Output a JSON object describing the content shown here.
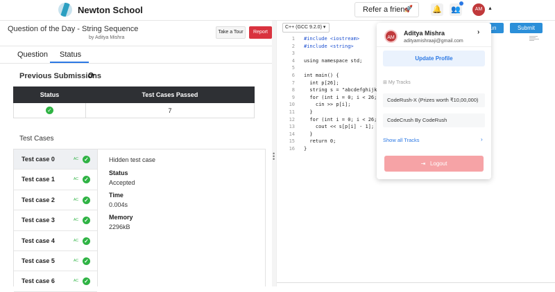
{
  "topbar": {
    "brand": "Newton School",
    "refer_label": "Refer a friend",
    "refer_icon": "rocket-icon",
    "avatar_initials": "AM"
  },
  "question": {
    "title": "Question of the Day - String Sequence",
    "author": "by Aditya Mishra",
    "tour_label": "Take a Tour",
    "report_label": "Report"
  },
  "tabs": [
    "Question",
    "Status"
  ],
  "active_tab": "Status",
  "submissions": {
    "heading": "Previous Submissions",
    "headers": [
      "Status",
      "Test Cases Passed"
    ],
    "rows": [
      {
        "status": "accepted",
        "passed": "7"
      }
    ]
  },
  "testcases": {
    "heading": "Test Cases",
    "items": [
      {
        "label": "Test case 0",
        "badge": "AC"
      },
      {
        "label": "Test case 1",
        "badge": "AC"
      },
      {
        "label": "Test case 2",
        "badge": "AC"
      },
      {
        "label": "Test case 3",
        "badge": "AC"
      },
      {
        "label": "Test case 4",
        "badge": "AC"
      },
      {
        "label": "Test case 5",
        "badge": "AC"
      },
      {
        "label": "Test case 6",
        "badge": "AC"
      }
    ],
    "detail": {
      "hidden": "Hidden test case",
      "status_label": "Status",
      "status_value": "Accepted",
      "time_label": "Time",
      "time_value": "0.004s",
      "memory_label": "Memory",
      "memory_value": "2296kB"
    }
  },
  "editor": {
    "language": "C++ (GCC 9.2.0)",
    "run_label": "un",
    "submit_label": "Submit",
    "lines": [
      "#include <iostream>",
      "#include <string>",
      "",
      "using namespace std;",
      "",
      "int main() {",
      "  int p[26];",
      "  string s = \"abcdefghijk",
      "  for (int i = 0; i < 26;",
      "    cin >> p[i];",
      "  }",
      "  for (int i = 0; i < 26;",
      "    cout << s[p[i] - 1];",
      "  }",
      "  return 0;",
      "}"
    ]
  },
  "dropdown": {
    "name": "Aditya Mishra",
    "email": "adityamishraaji@gmail.com",
    "update_label": "Update Profile",
    "tracks_heading": "My Tracks",
    "tracks": [
      "CodeRush-X (Prizes worth ₹10,00,000)",
      "CodeCrush By CodeRush"
    ],
    "show_all": "Show all Tracks",
    "logout_label": "Logout"
  },
  "colors": {
    "primary": "#2b78e4",
    "success": "#2fb344",
    "danger": "#d9333f",
    "table_header": "#2e3034"
  }
}
